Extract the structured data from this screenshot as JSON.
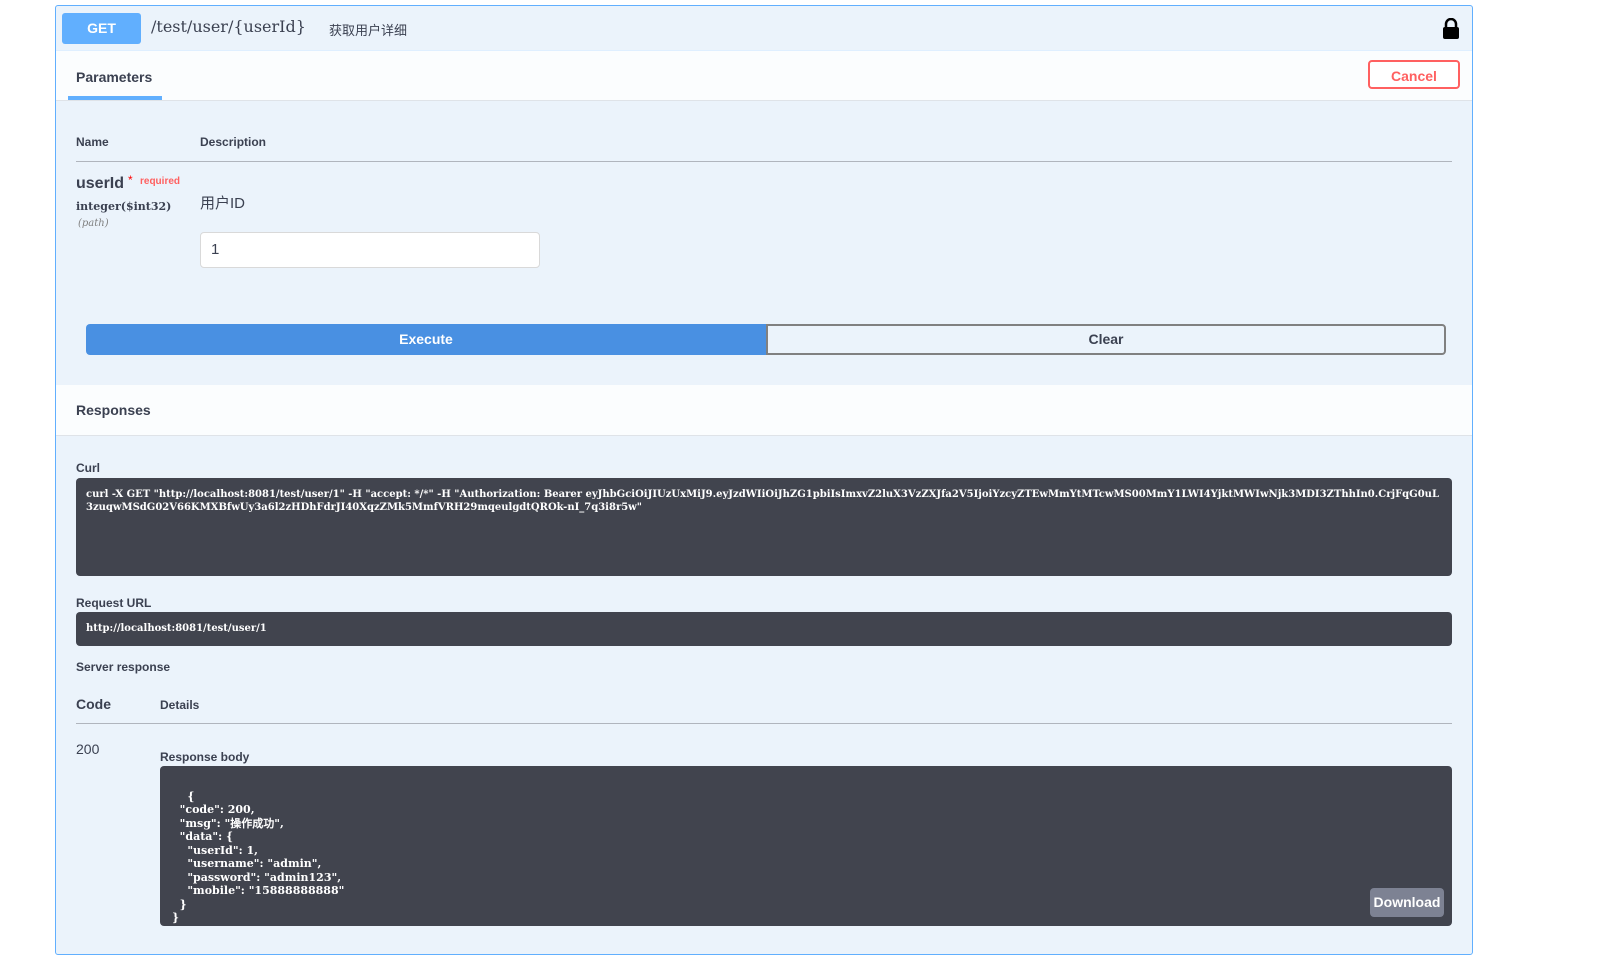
{
  "operation": {
    "method": "GET",
    "path": "/test/user/{userId}",
    "summary": "获取用户详细"
  },
  "tabs": {
    "parameters": "Parameters",
    "cancel": "Cancel"
  },
  "params_table": {
    "name_header": "Name",
    "description_header": "Description",
    "param": {
      "name": "userId",
      "star": "*",
      "required": "required",
      "type": "integer($int32)",
      "in": "(path)",
      "description": "用户ID",
      "value": "1"
    }
  },
  "actions": {
    "execute": "Execute",
    "clear": "Clear"
  },
  "responses": {
    "title": "Responses",
    "curl_label": "Curl",
    "curl": "curl -X GET \"http://localhost:8081/test/user/1\" -H \"accept: */*\" -H \"Authorization: Bearer eyJhbGciOiJIUzUxMiJ9.eyJzdWIiOiJhZG1pbiIsImxvZ2luX3VzZXJfa2V5IjoiYzcyZTEwMmYtMTcwMS00MmY1LWI4YjktMWIwNjk3MDI3ZThhIn0.CrjFqG0uL3zuqwMSdG02V66KMXBfwUy3a6l2zHDhFdrJI40XqzZMk5MmfVRH29mqeulgdtQROk-nI_7q3i8r5w\"",
    "request_url_label": "Request URL",
    "request_url": "http://localhost:8081/test/user/1",
    "server_response_label": "Server response",
    "code_header": "Code",
    "details_header": "Details",
    "code": "200",
    "body_label": "Response body",
    "body": "{\n  \"code\": 200,\n  \"msg\": \"操作成功\",\n  \"data\": {\n    \"userId\": 1,\n    \"username\": \"admin\",\n    \"password\": \"admin123\",\n    \"mobile\": \"15888888888\"\n  }\n}",
    "download": "Download"
  },
  "icons": {
    "lock": "lock-icon"
  },
  "colors": {
    "get_accent": "#61affe",
    "execute": "#4990e2",
    "cancel": "#ff6060",
    "code_bg": "#41444e"
  }
}
